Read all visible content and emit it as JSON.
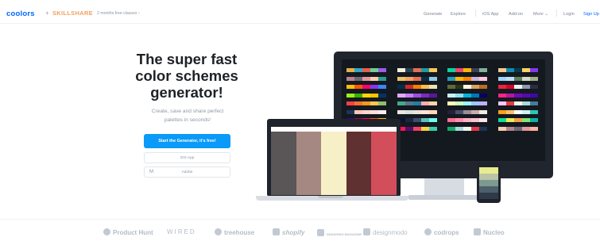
{
  "header": {
    "brand": "coolors",
    "plus": "+",
    "partner": "SKILLSHARE",
    "promo": "2 months free classes ›",
    "nav": [
      {
        "label": "Generate"
      },
      {
        "label": "Explore"
      },
      {
        "label": "iOS App"
      },
      {
        "label": "Add-on"
      },
      {
        "label": "More ⌄"
      },
      {
        "label": "Login"
      },
      {
        "label": "Sign Up"
      }
    ]
  },
  "hero": {
    "title_lines": [
      "The super fast",
      "color schemes",
      "generator!"
    ],
    "subtitle_lines": [
      "Create, save and share perfect",
      "palettes in seconds!"
    ],
    "cta_label": "Start the Generator, it's free!",
    "ios_label": "iOS App",
    "addon_label": "Adobe"
  },
  "devices": {
    "laptop_palette": [
      "#5a5557",
      "#a58882",
      "#f7efc6",
      "#5f3130",
      "#d24e5a"
    ],
    "phone_palette": [
      "#e8ec8c",
      "#b9c4a8",
      "#7d9a90",
      "#4c5f6a",
      "#2f3a48"
    ],
    "monitor_rows": [
      [
        "#e3b04b",
        "#2fa9c4",
        "#e85d4a",
        "#6fcf97",
        "#9b5de5",
        "#f4f1de",
        "#264653",
        "#e76f51",
        "#1b9aaa",
        "#ffc857",
        "#06d6a0",
        "#ef476f",
        "#f7b801",
        "#3d405b",
        "#81b29a",
        "#f2cc8f",
        "#118ab2",
        "#073b4c",
        "#ffd166",
        "#8338ec"
      ],
      [
        "#b5838d",
        "#6d6875",
        "#e5989b",
        "#ffcdb2",
        "#2a9d8f",
        "#e9c46a",
        "#f4a261",
        "#e76f51",
        "#023047",
        "#8ecae6",
        "#219ebc",
        "#ffb703",
        "#fb8500",
        "#cdb4db",
        "#ffc8dd",
        "#a2d2ff",
        "#bde0fe",
        "#588157",
        "#dad7cd",
        "#a3b18a"
      ],
      [
        "#ffbe0b",
        "#fb5607",
        "#ff006e",
        "#8338ec",
        "#3a86ff",
        "#003049",
        "#d62828",
        "#f77f00",
        "#fcbf49",
        "#eae2b7",
        "#606c38",
        "#283618",
        "#fefae0",
        "#dda15e",
        "#bc6c25",
        "#ef233c",
        "#d90429",
        "#edf2f4",
        "#8d99ae",
        "#2b2d42"
      ],
      [
        "#9ef01a",
        "#38b000",
        "#ffd60a",
        "#ffc300",
        "#003566",
        "#e0aaff",
        "#c77dff",
        "#9d4edd",
        "#7b2cbf",
        "#5a189a",
        "#caf0f8",
        "#90e0ef",
        "#00b4d8",
        "#0077b6",
        "#03045e",
        "#f72585",
        "#b5179e",
        "#7209b7",
        "#560bad",
        "#3a0ca3"
      ],
      [
        "#f94144",
        "#f3722c",
        "#f8961e",
        "#f9c74f",
        "#90be6d",
        "#43aa8b",
        "#577590",
        "#277da1",
        "#ffadad",
        "#ffd6a5",
        "#fdffb6",
        "#caffbf",
        "#9bf6ff",
        "#a0c4ff",
        "#bdb2ff",
        "#ffc6ff",
        "#e63946",
        "#f1faee",
        "#a8dadc",
        "#457b9d"
      ],
      [
        "#1d3557",
        "#fec5bb",
        "#fcd5ce",
        "#fae1dd",
        "#f8edeb",
        "#e8e8e4",
        "#d8e2dc",
        "#ece4db",
        "#ffe5d9",
        "#ffd7ba",
        "#22223b",
        "#4a4e69",
        "#9a8c98",
        "#c9ada7",
        "#f2e9e4",
        "#ff9f1c",
        "#ffbf69",
        "#ffffff",
        "#cbf3f0",
        "#2ec4b6"
      ],
      [
        "#390099",
        "#9e0059",
        "#ff0054",
        "#ff5400",
        "#ffbd00",
        "#0b132b",
        "#1c2541",
        "#3a506b",
        "#5bc0be",
        "#6fffe9",
        "#fb6f92",
        "#ff8fab",
        "#ffb3c6",
        "#ffc2d1",
        "#ffe5ec",
        "#16db93",
        "#efea5a",
        "#f29e4c",
        "#83e377",
        "#0db39e"
      ],
      [
        "#ffe066",
        "#247ba0",
        "#70c1b3",
        "#b2dbbf",
        "#f3ffbd",
        "#ff1654",
        "#540d6e",
        "#ee4266",
        "#ffd23f",
        "#3bceac",
        "#0ead69",
        "#a8dadc",
        "#f1faee",
        "#e63946",
        "#1d3557",
        "#ffcdb2",
        "#b5838d",
        "#6d6875",
        "#e5989b",
        "#ffb4a2"
      ]
    ]
  },
  "partners": [
    {
      "name": "Product Hunt",
      "icon": "product-hunt-icon"
    },
    {
      "name": "WIRED",
      "icon": "wired-icon"
    },
    {
      "name": "treehouse",
      "icon": "treehouse-icon"
    },
    {
      "name": "shopify",
      "icon": "shopify-icon"
    },
    {
      "name": "SMASHING MAGAZINE",
      "icon": "smashing-icon"
    },
    {
      "name": "designmodo",
      "icon": "designmodo-icon"
    },
    {
      "name": "codrops",
      "icon": "codrops-icon"
    },
    {
      "name": "Nucleo",
      "icon": "nucleo-icon"
    }
  ]
}
